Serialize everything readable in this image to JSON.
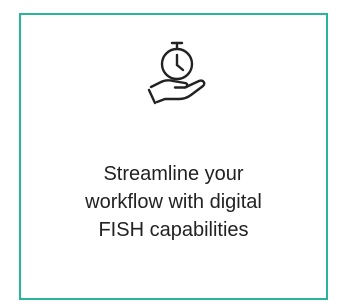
{
  "card": {
    "icon": "stopwatch-on-hand-icon",
    "caption_lines": [
      "Streamline your",
      "workflow with digital",
      "FISH capabilities"
    ],
    "border_color": "#29b59a"
  }
}
